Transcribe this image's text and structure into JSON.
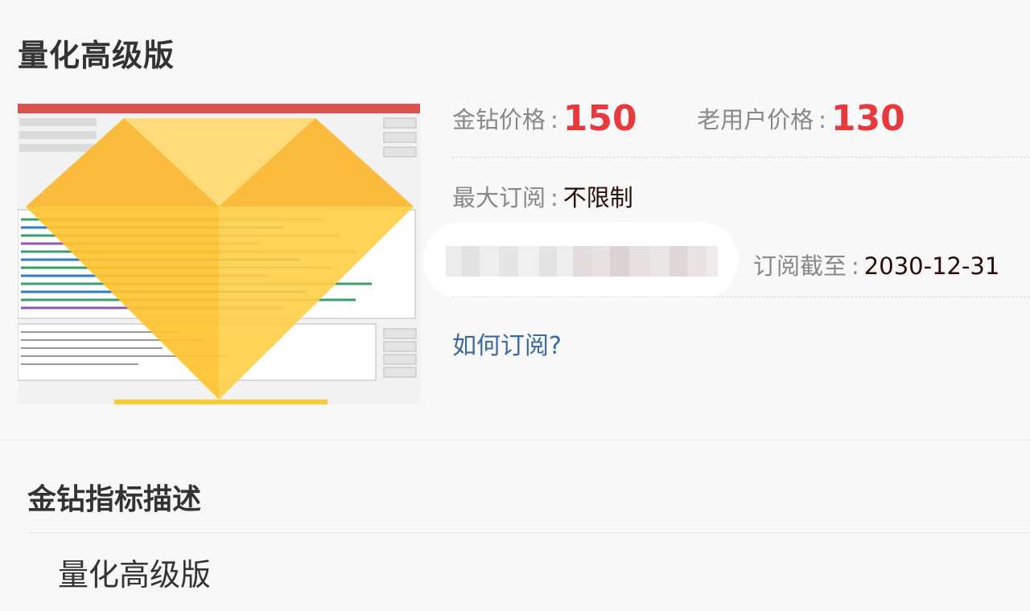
{
  "page": {
    "title": "量化高级版"
  },
  "product": {
    "image_alt": "金钻指标截图",
    "price_label": "金钻价格",
    "price_value": "150",
    "old_user_price_label": "老用户价格",
    "old_user_price_value": "130",
    "max_subscription_label": "最大订阅",
    "max_subscription_value": "不限制",
    "expiry_label": "订阅截至",
    "expiry_value": "2030-12-31",
    "how_to_subscribe": "如何订阅?"
  },
  "description": {
    "heading": "金钻指标描述",
    "text": "量化高级版"
  },
  "colors": {
    "price_red": "#e8393f",
    "link_blue": "#3a6aa0",
    "diamond_yellow": "#ffc933"
  },
  "icons": {
    "diamond": "diamond-icon"
  }
}
